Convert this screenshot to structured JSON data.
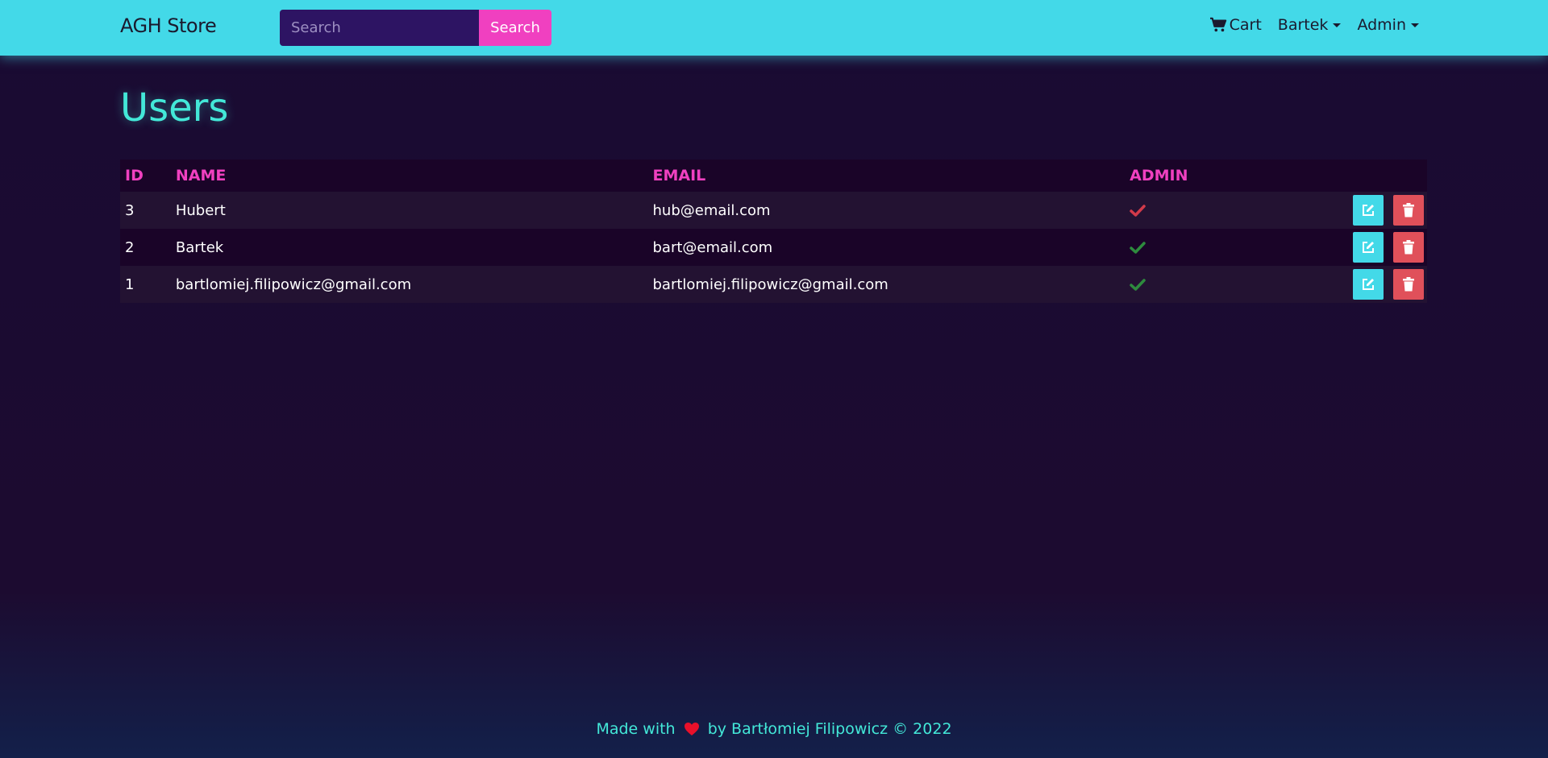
{
  "navbar": {
    "brand": "AGH Store",
    "search": {
      "placeholder": "Search",
      "value": "",
      "button_label": "Search"
    },
    "cart_label": "Cart",
    "user_menu_label": "Bartek",
    "admin_menu_label": "Admin"
  },
  "page": {
    "title": "Users"
  },
  "table": {
    "headers": {
      "id": "ID",
      "name": "NAME",
      "email": "EMAIL",
      "admin": "ADMIN"
    },
    "rows": [
      {
        "id": "3",
        "name": "Hubert",
        "email": "hub@email.com",
        "admin_icon": "check-icon",
        "admin_color": "#d23a4a"
      },
      {
        "id": "2",
        "name": "Bartek",
        "email": "bart@email.com",
        "admin_icon": "check-icon",
        "admin_color": "#2e8b3e"
      },
      {
        "id": "1",
        "name": "bartlomiej.filipowicz@gmail.com",
        "email": "bartlomiej.filipowicz@gmail.com",
        "admin_icon": "check-icon",
        "admin_color": "#2e8b3e"
      }
    ],
    "action_icons": {
      "edit": "edit-icon",
      "delete": "trash-icon"
    }
  },
  "footer": {
    "prefix": "Made with",
    "heart_icon": "heart-icon",
    "suffix": "by Bartłomiej Filipowicz © 2022"
  },
  "colors": {
    "navbar": "#43d9e8",
    "accent_pink": "#f040c0",
    "title_cyan": "#43e8d8",
    "edit_button": "#43d9e8",
    "delete_button": "#e0505a"
  }
}
